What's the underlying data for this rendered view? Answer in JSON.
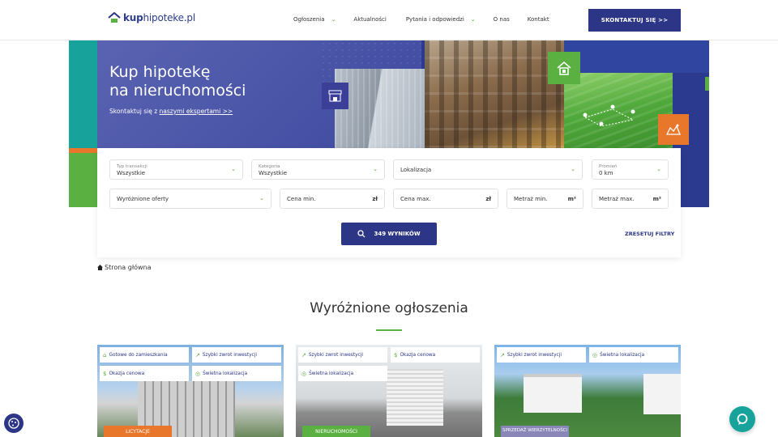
{
  "header": {
    "logo": {
      "part1": "kup",
      "part2": "hipoteke.pl"
    },
    "nav": [
      {
        "label": "Ogłoszenia",
        "dropdown": true
      },
      {
        "label": "Aktualności",
        "dropdown": false
      },
      {
        "label": "Pytania i odpowiedzi",
        "dropdown": true
      },
      {
        "label": "O nas",
        "dropdown": false
      },
      {
        "label": "Kontakt",
        "dropdown": false
      }
    ],
    "cta": "SKONTAKTUJ SIĘ >>"
  },
  "hero": {
    "title_line1": "Kup hipotekę",
    "title_line2": "na nieruchomości",
    "subtitle_prefix": "Skontaktuj się z ",
    "subtitle_link": "naszymi ekspertami >>"
  },
  "search": {
    "transaction": {
      "label": "Typ transakcji",
      "value": "Wszystkie"
    },
    "category": {
      "label": "Kategoria",
      "value": "Wszystkie"
    },
    "location": {
      "placeholder": "Lokalizacja"
    },
    "radius": {
      "label": "Promień",
      "value": "0 km"
    },
    "featured": {
      "placeholder": "Wyróżnione oferty"
    },
    "price_min": {
      "placeholder": "Cena min.",
      "unit": "zł"
    },
    "price_max": {
      "placeholder": "Cena max.",
      "unit": "zł"
    },
    "area_min": {
      "placeholder": "Metraż min.",
      "unit": "m²"
    },
    "area_max": {
      "placeholder": "Metraż max.",
      "unit": "m²"
    },
    "button": "349 WYNIKÓW",
    "reset": "ZRESETUJ FILTRY"
  },
  "breadcrumb": {
    "home": "Strona główna"
  },
  "section": {
    "title": "Wyróżnione ogłoszenia"
  },
  "cards": [
    {
      "badges": [
        "Gotowe do zamieszkania",
        "Szybki zwrot inwestycji",
        "Okazja cenowa",
        "Świetna lokalizacja"
      ],
      "ribbon": "LICYTACJE",
      "ribbon_color": "#e9772b"
    },
    {
      "badges": [
        "Szybki zwrot inwestycji",
        "Okazja cenowa",
        "Świetna lokalizacja"
      ],
      "ribbon": "NIERUCHOMOŚCI",
      "ribbon_color": "#5bb042"
    },
    {
      "badges": [
        "Szybki zwrot inwestycji",
        "Świetna lokalizacja"
      ],
      "ribbon": "SPRZEDAŻ WIERZYTELNOŚCI",
      "ribbon_color": "#8a86b8"
    }
  ],
  "colors": {
    "primary": "#2c3586",
    "green": "#5bb042",
    "orange": "#e9772b",
    "teal": "#17a29b"
  }
}
